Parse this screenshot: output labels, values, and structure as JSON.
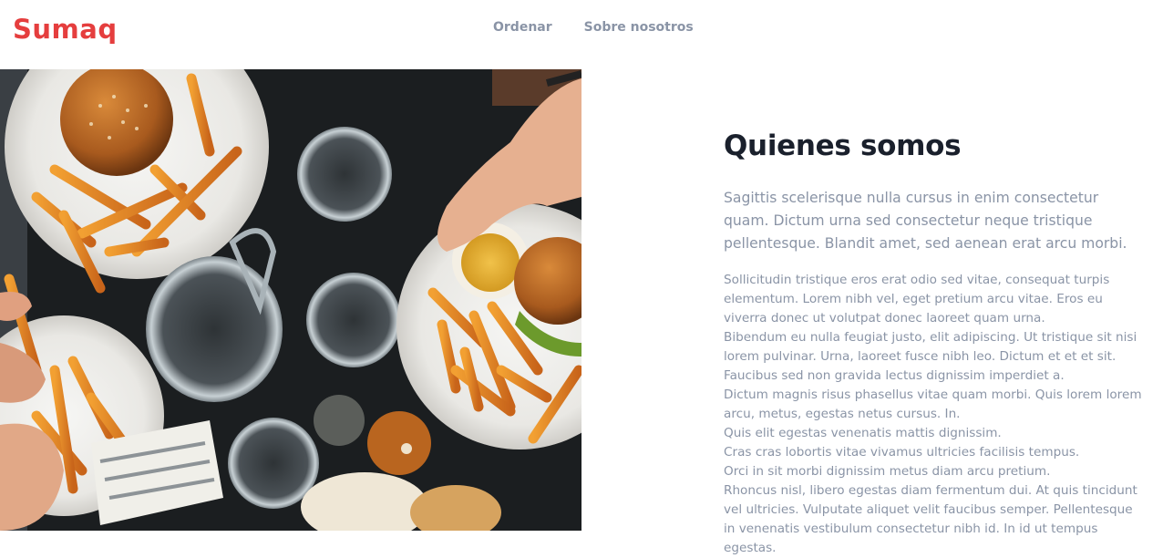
{
  "brand": {
    "name": "Sumaq",
    "color": "#e53e3e"
  },
  "nav": {
    "items": [
      "Ordenar",
      "Sobre nosotros"
    ]
  },
  "hero_image": {
    "icon": "food-table-photo-icon"
  },
  "about": {
    "title": "Quienes somos",
    "lead": "Sagittis scelerisque nulla cursus in enim consectetur quam. Dictum urna sed consectetur neque tristique pellentesque. Blandit amet, sed aenean erat arcu morbi.",
    "paragraphs": [
      "Sollicitudin tristique eros erat odio sed vitae, consequat turpis elementum. Lorem nibh vel, eget pretium arcu vitae. Eros eu viverra donec ut volutpat donec laoreet quam urna.",
      "Bibendum eu nulla feugiat justo, elit adipiscing. Ut tristique sit nisi lorem pulvinar. Urna, laoreet fusce nibh leo. Dictum et et et sit. Faucibus sed non gravida lectus dignissim imperdiet a.",
      "Dictum magnis risus phasellus vitae quam morbi. Quis lorem lorem arcu, metus, egestas netus cursus. In.",
      "Quis elit egestas venenatis mattis dignissim.",
      "Cras cras lobortis vitae vivamus ultricies facilisis tempus.",
      "Orci in sit morbi dignissim metus diam arcu pretium.",
      "Rhoncus nisl, libero egestas diam fermentum dui. At quis tincidunt vel ultricies. Vulputate aliquet velit faucibus semper. Pellentesque in venenatis vestibulum consectetur nibh id. In id ut tempus egestas."
    ]
  }
}
